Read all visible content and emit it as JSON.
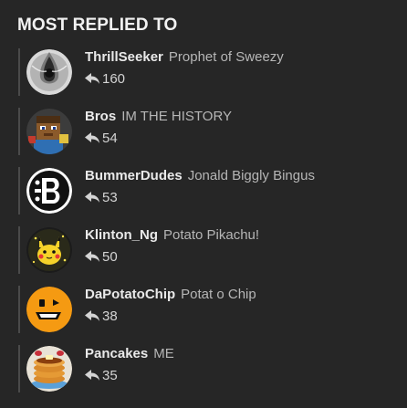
{
  "widget": {
    "title": "MOST REPLIED TO"
  },
  "entries": [
    {
      "username": "ThrillSeeker",
      "user_title": "Prophet of Sweezy",
      "reply_count": "160",
      "avatar_icon": "black-hole-avatar-icon"
    },
    {
      "username": "Bros",
      "user_title": "IM THE HISTORY",
      "reply_count": "54",
      "avatar_icon": "blocky-character-avatar-icon"
    },
    {
      "username": "BummerDudes",
      "user_title": "Jonald Biggly Bingus",
      "reply_count": "53",
      "avatar_icon": "b-letter-avatar-icon"
    },
    {
      "username": "Klinton_Ng",
      "user_title": "Potato Pikachu!",
      "reply_count": "50",
      "avatar_icon": "pikachu-avatar-icon"
    },
    {
      "username": "DaPotatoChip",
      "user_title": "Potat o Chip",
      "reply_count": "38",
      "avatar_icon": "orange-face-avatar-icon"
    },
    {
      "username": "Pancakes",
      "user_title": "ME",
      "reply_count": "35",
      "avatar_icon": "pancakes-avatar-icon"
    }
  ],
  "colors": {
    "background": "#262626",
    "username": "#e9e9e9",
    "user_title": "#b6b6b6",
    "divider": "#4a4a4a"
  }
}
